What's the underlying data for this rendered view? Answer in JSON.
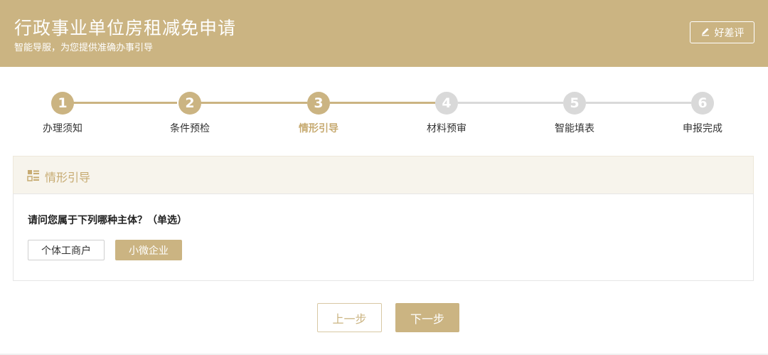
{
  "header": {
    "title": "行政事业单位房租减免申请",
    "subtitle": "智能导服，为您提供准确办事引导",
    "review_button": {
      "label": "好差评",
      "icon": "pencil-icon"
    }
  },
  "steps": {
    "current": 3,
    "items": [
      {
        "number": "1",
        "label": "办理须知"
      },
      {
        "number": "2",
        "label": "条件预检"
      },
      {
        "number": "3",
        "label": "情形引导"
      },
      {
        "number": "4",
        "label": "材料预审"
      },
      {
        "number": "5",
        "label": "智能填表"
      },
      {
        "number": "6",
        "label": "申报完成"
      }
    ]
  },
  "panel": {
    "icon": "list-grid-icon",
    "title": "情形引导",
    "question": "请问您属于下列哪种主体？（单选）",
    "options": [
      {
        "label": "个体工商户",
        "selected": false
      },
      {
        "label": "小微企业",
        "selected": true
      }
    ]
  },
  "footer": {
    "prev_label": "上一步",
    "next_label": "下一步"
  },
  "colors": {
    "accent": "#cbb482",
    "accent_text": "#c7ab72",
    "inactive": "#d9d9d9",
    "panel_head_bg": "#f7f4ec"
  }
}
